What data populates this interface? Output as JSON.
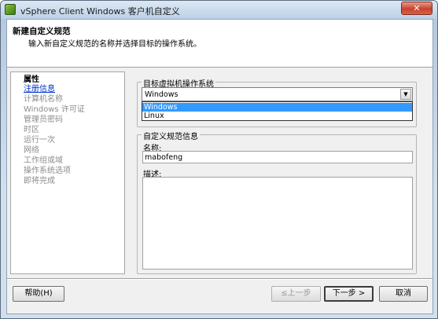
{
  "window": {
    "title": "vSphere Client Windows 客户机自定义",
    "close_glyph": "✕"
  },
  "header": {
    "title": "新建自定义规范",
    "subtitle": "输入新自定义规范的名称并选择目标的操作系统。"
  },
  "sidebar": {
    "items": [
      {
        "label": "属性",
        "state": "section"
      },
      {
        "label": "注册信息",
        "state": "current"
      },
      {
        "label": "计算机名称",
        "state": "pending"
      },
      {
        "label": "Windows 许可证",
        "state": "pending"
      },
      {
        "label": "管理员密码",
        "state": "pending"
      },
      {
        "label": "时区",
        "state": "pending"
      },
      {
        "label": "运行一次",
        "state": "pending"
      },
      {
        "label": "网络",
        "state": "pending"
      },
      {
        "label": "工作组或域",
        "state": "pending"
      },
      {
        "label": "操作系统选项",
        "state": "pending"
      },
      {
        "label": "即将完成",
        "state": "pending"
      }
    ]
  },
  "os_group": {
    "legend": "目标虚拟机操作系统",
    "selected": "Windows",
    "arrow_glyph": "▼",
    "options": [
      "Windows",
      "Linux"
    ]
  },
  "info_group": {
    "legend": "自定义规范信息",
    "name_label": "名称:",
    "name_value": "mabofeng",
    "desc_label": "描述:",
    "desc_value": ""
  },
  "buttons": {
    "help": "帮助(H)",
    "back": "≤上一步",
    "next": "下一步 >",
    "cancel": "取消"
  },
  "colors": {
    "link": "#0033cc",
    "highlight": "#3399ff",
    "disabled_text": "#8c8c8c"
  }
}
